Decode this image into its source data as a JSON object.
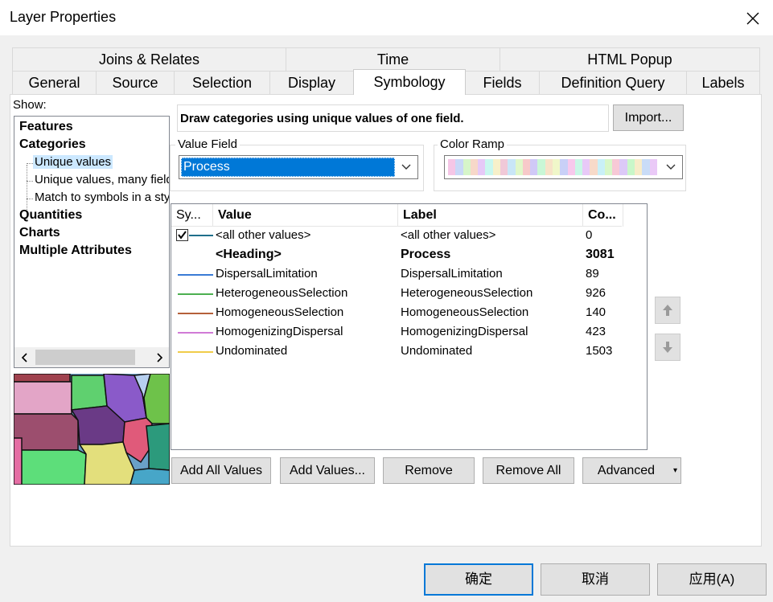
{
  "window": {
    "title": "Layer Properties"
  },
  "tabs_row1": [
    {
      "label": "Joins & Relates"
    },
    {
      "label": "Time"
    },
    {
      "label": "HTML Popup"
    }
  ],
  "tabs_row2": [
    {
      "label": "General"
    },
    {
      "label": "Source"
    },
    {
      "label": "Selection"
    },
    {
      "label": "Display"
    },
    {
      "label": "Symbology",
      "active": true
    },
    {
      "label": "Fields"
    },
    {
      "label": "Definition Query"
    },
    {
      "label": "Labels"
    }
  ],
  "show": {
    "label": "Show:",
    "items": [
      {
        "label": "Features",
        "bold": true
      },
      {
        "label": "Categories",
        "bold": true
      },
      {
        "label": "Unique values",
        "selected": true
      },
      {
        "label": "Unique values, many fields"
      },
      {
        "label": "Match to symbols in a style"
      },
      {
        "label": "Quantities",
        "bold": true
      },
      {
        "label": "Charts",
        "bold": true
      },
      {
        "label": "Multiple Attributes",
        "bold": true
      }
    ]
  },
  "symbology": {
    "description": "Draw categories using unique values of one field.",
    "import_label": "Import...",
    "value_field": {
      "label": "Value Field",
      "selected": "Process"
    },
    "color_ramp": {
      "label": "Color Ramp",
      "colors": [
        "#f5c6e6",
        "#c9d8f7",
        "#d6f5c9",
        "#f7d8c9",
        "#e6c9f7",
        "#c9f7ef",
        "#f7f0c9",
        "#f0c9d8",
        "#c9e6f7",
        "#e0f7c9",
        "#f7c9c9",
        "#d0c9f7",
        "#c9f7d6",
        "#f7e3c9",
        "#f0f7c9",
        "#c9d0f7",
        "#f7c9ec",
        "#c9f7e6",
        "#e8c9f7",
        "#f7dac9",
        "#c9f0f7",
        "#d8f7c9",
        "#f7c9d6",
        "#dcc9f7",
        "#c9f7c9",
        "#f7ecc9",
        "#c9dcf7",
        "#eac9f7"
      ]
    },
    "columns": {
      "symbol": "Sy...",
      "value": "Value",
      "label": "Label",
      "count": "Co..."
    },
    "rows": [
      {
        "value": "<all other values>",
        "label": "<all other values>",
        "count": "0",
        "color": "#1f6f8b",
        "checkbox": true
      },
      {
        "value": "<Heading>",
        "label": "Process",
        "count": "3081",
        "heading": true
      },
      {
        "value": "DispersalLimitation",
        "label": "DispersalLimitation",
        "count": "89",
        "color": "#3a7bd5"
      },
      {
        "value": "HeterogeneousSelection",
        "label": "HeterogeneousSelection",
        "count": "926",
        "color": "#4caf50"
      },
      {
        "value": "HomogeneousSelection",
        "label": "HomogeneousSelection",
        "count": "140",
        "color": "#b5603a"
      },
      {
        "value": "HomogenizingDispersal",
        "label": "HomogenizingDispersal",
        "count": "423",
        "color": "#d07ad6"
      },
      {
        "value": "Undominated",
        "label": "Undominated",
        "count": "1503",
        "color": "#f0cc4a"
      }
    ],
    "buttons": {
      "add_all": "Add All Values",
      "add_values": "Add Values...",
      "remove": "Remove",
      "remove_all": "Remove All",
      "advanced": "Advanced"
    }
  },
  "footer": {
    "ok": "确定",
    "cancel": "取消",
    "apply": "应用(A)"
  }
}
